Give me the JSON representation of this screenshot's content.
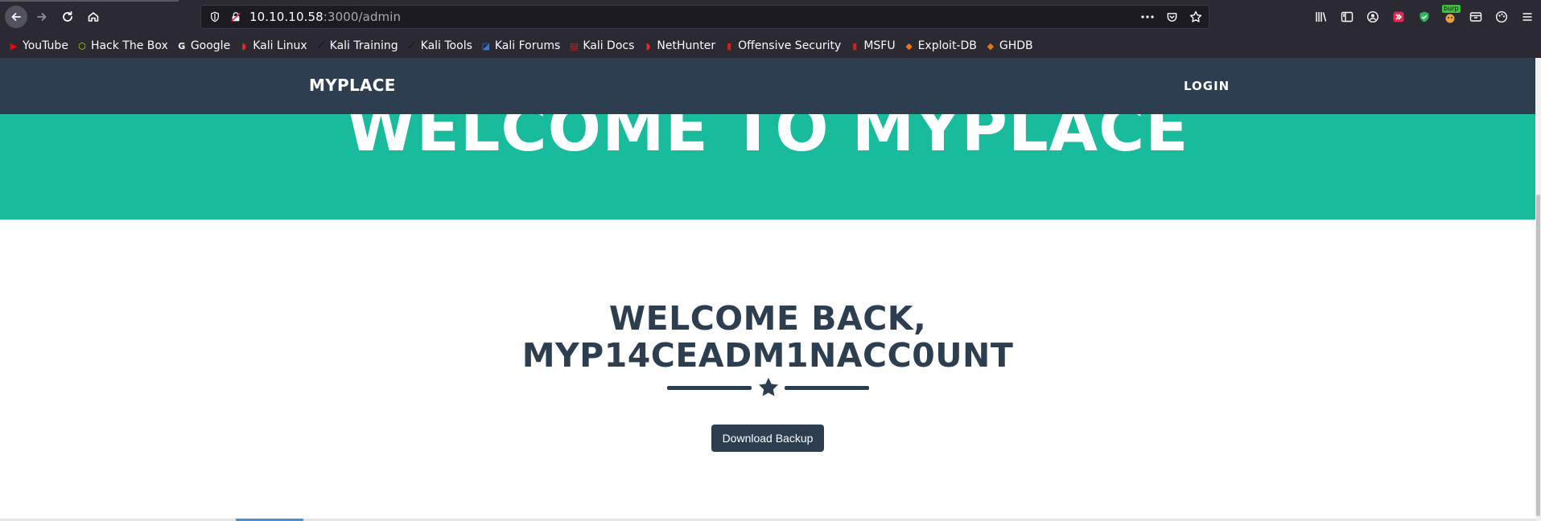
{
  "browser": {
    "url_host": "10.10.10.58",
    "url_rest": ":3000/admin",
    "icons": {
      "back": "back-arrow-icon",
      "forward": "forward-arrow-icon",
      "reload": "reload-icon",
      "home": "home-icon",
      "shield": "tracking-shield-icon",
      "insecure": "insecure-lock-icon",
      "more": "more-actions-icon",
      "pocket": "pocket-icon",
      "bookmark": "bookmark-star-icon"
    },
    "extensions": {
      "burp_label": "burp"
    }
  },
  "bookmarks": [
    {
      "label": "YouTube",
      "icon": "youtube-icon",
      "color": "#ff0000"
    },
    {
      "label": "Hack The Box",
      "icon": "hackthebox-icon",
      "color": "#9fef00"
    },
    {
      "label": "Google",
      "icon": "google-icon",
      "color": "#ffffff"
    },
    {
      "label": "Kali Linux",
      "icon": "kali-icon",
      "color": "#e02a2a"
    },
    {
      "label": "Kali Training",
      "icon": "kali-dragon-icon",
      "color": "#111111"
    },
    {
      "label": "Kali Tools",
      "icon": "kali-dragon-icon",
      "color": "#111111"
    },
    {
      "label": "Kali Forums",
      "icon": "kali-forums-icon",
      "color": "#2f7bd6"
    },
    {
      "label": "Kali Docs",
      "icon": "kali-docs-icon",
      "color": "#cc2222"
    },
    {
      "label": "NetHunter",
      "icon": "nethunter-icon",
      "color": "#e02a2a"
    },
    {
      "label": "Offensive Security",
      "icon": "offsec-icon",
      "color": "#d11f1f"
    },
    {
      "label": "MSFU",
      "icon": "msfu-icon",
      "color": "#d11f1f"
    },
    {
      "label": "Exploit-DB",
      "icon": "exploitdb-icon",
      "color": "#e8741c"
    },
    {
      "label": "GHDB",
      "icon": "ghdb-icon",
      "color": "#e8741c"
    }
  ],
  "site": {
    "brand": "MYPLACE",
    "nav_login": "LOGIN",
    "hero_title": "WELCOME TO MYPLACE",
    "welcome_line1": "WELCOME BACK,",
    "welcome_line2": "MYP14CEADM1NACC0UNT",
    "download_button": "Download Backup",
    "colors": {
      "nav_bg": "#2c3e50",
      "hero_bg": "#18bc9c",
      "text_dark": "#2c3e50"
    }
  }
}
